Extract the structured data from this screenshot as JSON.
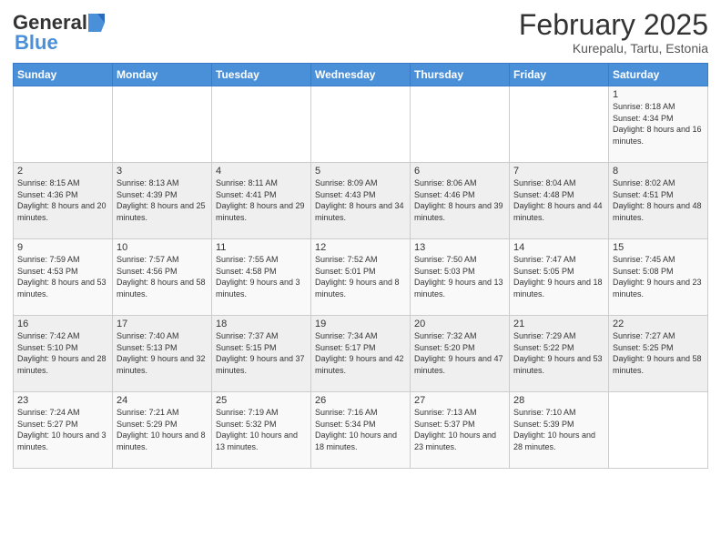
{
  "header": {
    "logo_general": "General",
    "logo_blue": "Blue",
    "title": "February 2025",
    "subtitle": "Kurepalu, Tartu, Estonia"
  },
  "weekdays": [
    "Sunday",
    "Monday",
    "Tuesday",
    "Wednesday",
    "Thursday",
    "Friday",
    "Saturday"
  ],
  "weeks": [
    [
      {
        "day": "",
        "info": ""
      },
      {
        "day": "",
        "info": ""
      },
      {
        "day": "",
        "info": ""
      },
      {
        "day": "",
        "info": ""
      },
      {
        "day": "",
        "info": ""
      },
      {
        "day": "",
        "info": ""
      },
      {
        "day": "1",
        "info": "Sunrise: 8:18 AM\nSunset: 4:34 PM\nDaylight: 8 hours and 16 minutes."
      }
    ],
    [
      {
        "day": "2",
        "info": "Sunrise: 8:15 AM\nSunset: 4:36 PM\nDaylight: 8 hours and 20 minutes."
      },
      {
        "day": "3",
        "info": "Sunrise: 8:13 AM\nSunset: 4:39 PM\nDaylight: 8 hours and 25 minutes."
      },
      {
        "day": "4",
        "info": "Sunrise: 8:11 AM\nSunset: 4:41 PM\nDaylight: 8 hours and 29 minutes."
      },
      {
        "day": "5",
        "info": "Sunrise: 8:09 AM\nSunset: 4:43 PM\nDaylight: 8 hours and 34 minutes."
      },
      {
        "day": "6",
        "info": "Sunrise: 8:06 AM\nSunset: 4:46 PM\nDaylight: 8 hours and 39 minutes."
      },
      {
        "day": "7",
        "info": "Sunrise: 8:04 AM\nSunset: 4:48 PM\nDaylight: 8 hours and 44 minutes."
      },
      {
        "day": "8",
        "info": "Sunrise: 8:02 AM\nSunset: 4:51 PM\nDaylight: 8 hours and 48 minutes."
      }
    ],
    [
      {
        "day": "9",
        "info": "Sunrise: 7:59 AM\nSunset: 4:53 PM\nDaylight: 8 hours and 53 minutes."
      },
      {
        "day": "10",
        "info": "Sunrise: 7:57 AM\nSunset: 4:56 PM\nDaylight: 8 hours and 58 minutes."
      },
      {
        "day": "11",
        "info": "Sunrise: 7:55 AM\nSunset: 4:58 PM\nDaylight: 9 hours and 3 minutes."
      },
      {
        "day": "12",
        "info": "Sunrise: 7:52 AM\nSunset: 5:01 PM\nDaylight: 9 hours and 8 minutes."
      },
      {
        "day": "13",
        "info": "Sunrise: 7:50 AM\nSunset: 5:03 PM\nDaylight: 9 hours and 13 minutes."
      },
      {
        "day": "14",
        "info": "Sunrise: 7:47 AM\nSunset: 5:05 PM\nDaylight: 9 hours and 18 minutes."
      },
      {
        "day": "15",
        "info": "Sunrise: 7:45 AM\nSunset: 5:08 PM\nDaylight: 9 hours and 23 minutes."
      }
    ],
    [
      {
        "day": "16",
        "info": "Sunrise: 7:42 AM\nSunset: 5:10 PM\nDaylight: 9 hours and 28 minutes."
      },
      {
        "day": "17",
        "info": "Sunrise: 7:40 AM\nSunset: 5:13 PM\nDaylight: 9 hours and 32 minutes."
      },
      {
        "day": "18",
        "info": "Sunrise: 7:37 AM\nSunset: 5:15 PM\nDaylight: 9 hours and 37 minutes."
      },
      {
        "day": "19",
        "info": "Sunrise: 7:34 AM\nSunset: 5:17 PM\nDaylight: 9 hours and 42 minutes."
      },
      {
        "day": "20",
        "info": "Sunrise: 7:32 AM\nSunset: 5:20 PM\nDaylight: 9 hours and 47 minutes."
      },
      {
        "day": "21",
        "info": "Sunrise: 7:29 AM\nSunset: 5:22 PM\nDaylight: 9 hours and 53 minutes."
      },
      {
        "day": "22",
        "info": "Sunrise: 7:27 AM\nSunset: 5:25 PM\nDaylight: 9 hours and 58 minutes."
      }
    ],
    [
      {
        "day": "23",
        "info": "Sunrise: 7:24 AM\nSunset: 5:27 PM\nDaylight: 10 hours and 3 minutes."
      },
      {
        "day": "24",
        "info": "Sunrise: 7:21 AM\nSunset: 5:29 PM\nDaylight: 10 hours and 8 minutes."
      },
      {
        "day": "25",
        "info": "Sunrise: 7:19 AM\nSunset: 5:32 PM\nDaylight: 10 hours and 13 minutes."
      },
      {
        "day": "26",
        "info": "Sunrise: 7:16 AM\nSunset: 5:34 PM\nDaylight: 10 hours and 18 minutes."
      },
      {
        "day": "27",
        "info": "Sunrise: 7:13 AM\nSunset: 5:37 PM\nDaylight: 10 hours and 23 minutes."
      },
      {
        "day": "28",
        "info": "Sunrise: 7:10 AM\nSunset: 5:39 PM\nDaylight: 10 hours and 28 minutes."
      },
      {
        "day": "",
        "info": ""
      }
    ]
  ]
}
